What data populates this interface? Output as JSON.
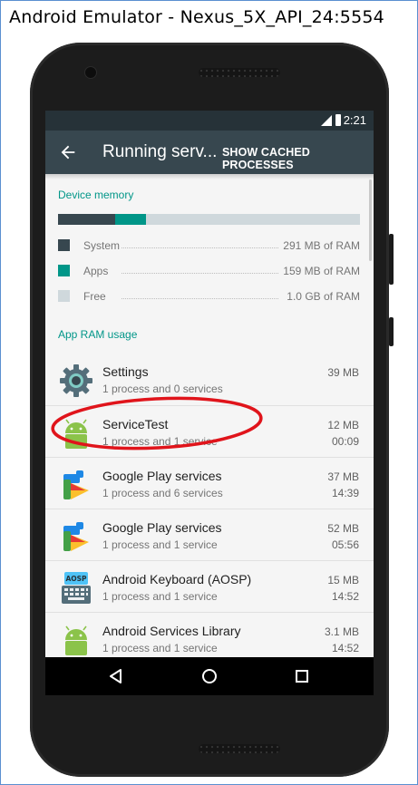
{
  "window": {
    "title": "Android Emulator - Nexus_5X_API_24:5554"
  },
  "status_bar": {
    "time": "2:21",
    "network": "LTE"
  },
  "app_bar": {
    "title": "Running serv...",
    "action": "SHOW CACHED PROCESSES"
  },
  "device_memory": {
    "header": "Device memory",
    "bar_fractions": {
      "system": 0.19,
      "apps": 0.1,
      "free": 0.71
    },
    "legend": [
      {
        "label": "System",
        "value": "291 MB of RAM",
        "color": "#37474f"
      },
      {
        "label": "Apps",
        "value": "159 MB of RAM",
        "color": "#009688"
      },
      {
        "label": "Free",
        "value": "1.0 GB of RAM",
        "color": "#cfd8dc"
      }
    ]
  },
  "app_ram": {
    "header": "App RAM usage",
    "items": [
      {
        "name": "Settings",
        "detail": "1 process and 0 services",
        "size": "39 MB",
        "time": "",
        "icon": "settings-gear-icon"
      },
      {
        "name": "ServiceTest",
        "detail": "1 process and 1 service",
        "size": "12 MB",
        "time": "00:09",
        "icon": "android-robot-icon"
      },
      {
        "name": "Google Play services",
        "detail": "1 process and 6 services",
        "size": "37 MB",
        "time": "14:39",
        "icon": "google-play-services-icon"
      },
      {
        "name": "Google Play services",
        "detail": "1 process and 1 service",
        "size": "52 MB",
        "time": "05:56",
        "icon": "google-play-services-icon"
      },
      {
        "name": "Android Keyboard (AOSP)",
        "detail": "1 process and 1 service",
        "size": "15 MB",
        "time": "14:52",
        "icon": "keyboard-icon"
      },
      {
        "name": "Android Services Library",
        "detail": "1 process and 1 service",
        "size": "3.1 MB",
        "time": "14:52",
        "icon": "android-robot-icon"
      }
    ]
  },
  "keyboard_icon_label": "AOSP",
  "accent_colors": {
    "teal": "#009688",
    "annotation": "#e0141b",
    "appbar": "#37474f"
  }
}
